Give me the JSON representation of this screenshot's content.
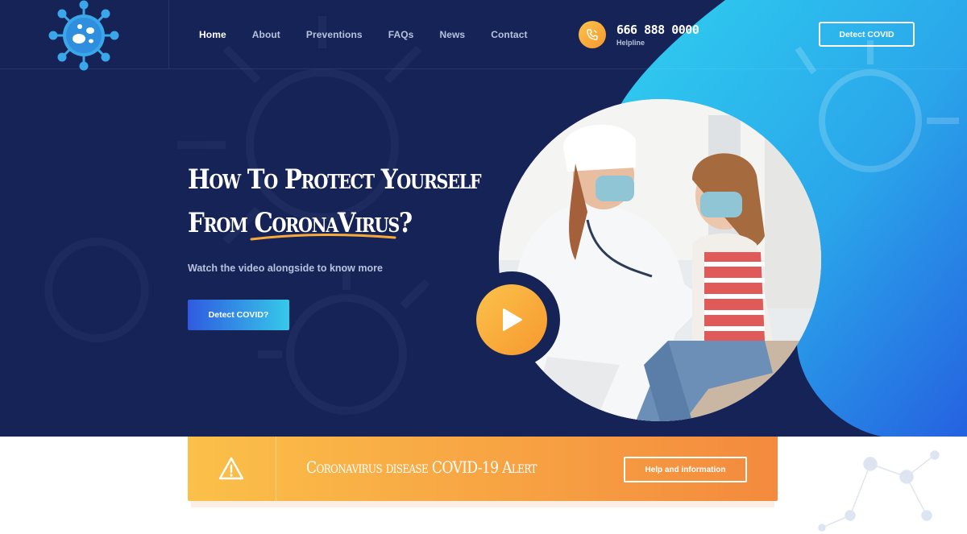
{
  "header": {
    "nav": [
      "Home",
      "About",
      "Preventions",
      "FAQs",
      "News",
      "Contact"
    ],
    "active_nav": "Home",
    "phone_number": "666 888 0000",
    "phone_label": "Helpline",
    "cta_label": "Detect COVID"
  },
  "hero": {
    "headline_line1": "How To Protect Yourself",
    "headline_line2": "From CoronaVirus?",
    "subtitle": "Watch the video alongside to know more",
    "cta_label": "Detect COVID?"
  },
  "alert": {
    "text": "Coronavirus disease COVID-19 Alert",
    "button_label": "Help and information"
  },
  "colors": {
    "navy": "#162356",
    "accent_blue": "#2f5ae0",
    "accent_cyan": "#36c9ea",
    "accent_orange": "#f7982f",
    "accent_yellow": "#fbc24a"
  },
  "icons": [
    "virus-logo-icon",
    "phone-icon",
    "play-icon",
    "warning-icon"
  ]
}
